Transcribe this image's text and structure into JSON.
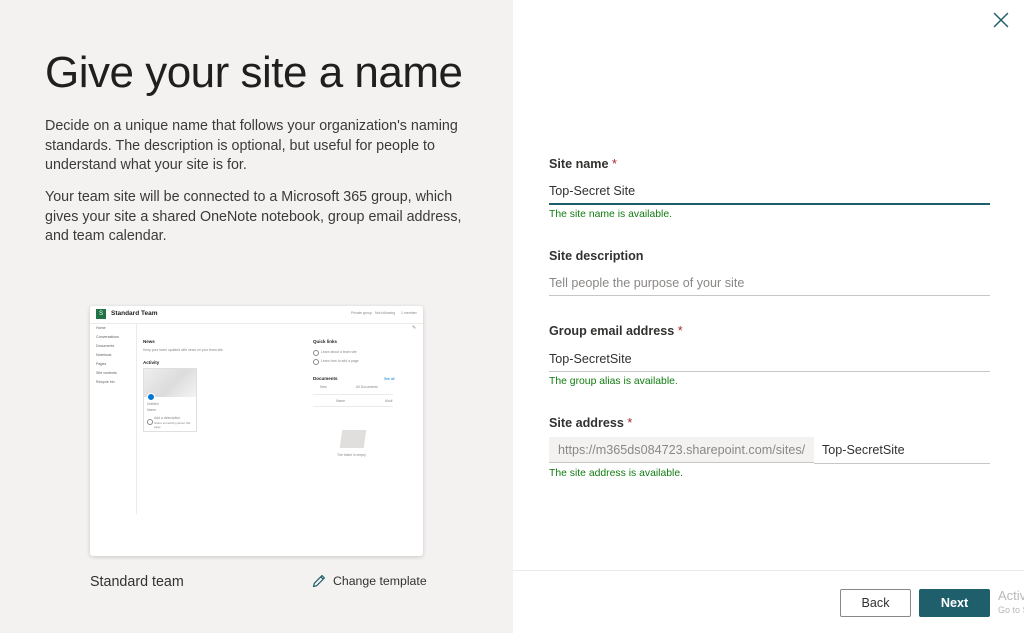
{
  "left_panel": {
    "title": "Give your site a name",
    "paragraph1": "Decide on a unique name that follows your organization's naming standards. The description is optional, but useful for people to understand what your site is for.",
    "paragraph2": "Your team site will be connected to a Microsoft 365 group, which gives your site a shared OneNote notebook, group email address, and team calendar.",
    "preview": {
      "logo_letter": "S",
      "site_title": "Standard Team",
      "top_actions": [
        "Private group",
        "Not following",
        "1 member"
      ],
      "nav": [
        "Home",
        "Conversations",
        "Documents",
        "Notebook",
        "Pages",
        "Site contents",
        "Recycle bin"
      ],
      "news_heading": "News",
      "news_text": "Keep your team updated with news on your team site",
      "activity_heading": "Activity",
      "card_line1": "Untitled",
      "card_line2": "Name",
      "card_line3": "Add a description",
      "card_line4": "Share something about this page",
      "quick_links_heading": "Quick links",
      "quick_link_1": "Learn about a team site",
      "quick_link_2": "Learn how to add a page",
      "documents_heading": "Documents",
      "see_all": "See all",
      "doc_new": "New",
      "doc_all": "All Documents",
      "doc_col_name": "Name",
      "doc_col_modified": "Modi",
      "empty_text": "The folder is empty"
    },
    "template_label": "Standard team",
    "change_template": "Change template"
  },
  "form": {
    "site_name": {
      "label": "Site name",
      "required": "*",
      "value": "Top-Secret Site",
      "status": "The site name is available."
    },
    "site_description": {
      "label": "Site description",
      "placeholder": "Tell people the purpose of your site",
      "value": ""
    },
    "group_email": {
      "label": "Group email address",
      "required": "*",
      "value": "Top-SecretSite",
      "status": "The group alias is available."
    },
    "site_address": {
      "label": "Site address",
      "required": "*",
      "prefix": "https://m365ds084723.sharepoint.com/sites/",
      "value": "Top-SecretSite",
      "status": "The site address is available."
    }
  },
  "footer": {
    "back_label": "Back",
    "next_label": "Next"
  },
  "watermark": {
    "line1": "Activate",
    "line2": "Go to Setti"
  },
  "colors": {
    "accent": "#1f5f6b",
    "success": "#107c10",
    "required": "#a4262c",
    "left_bg": "#f3f2f1"
  }
}
